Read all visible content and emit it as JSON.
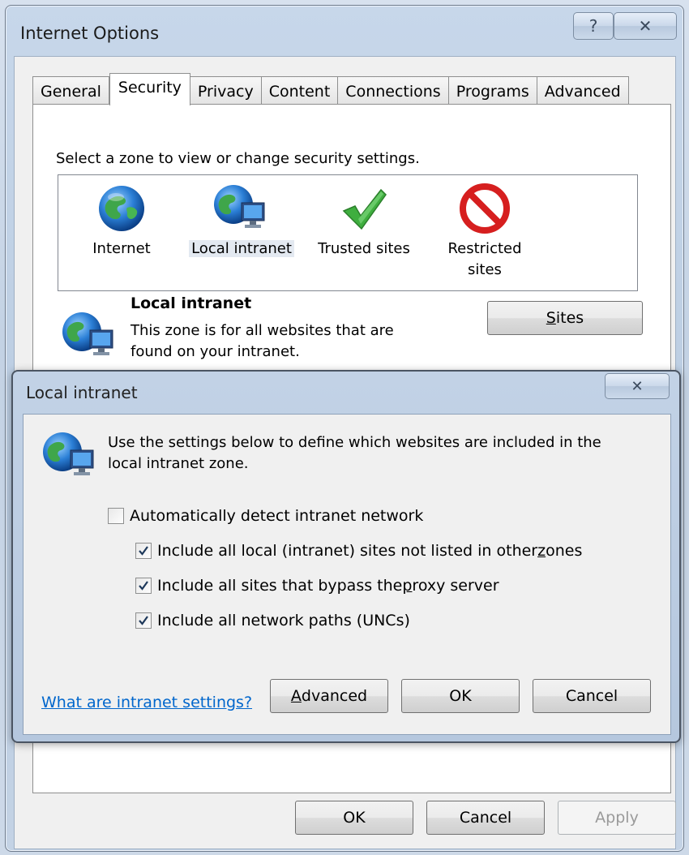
{
  "window": {
    "title": "Internet Options",
    "help_glyph": "?",
    "close_glyph": "✕"
  },
  "tabs": [
    {
      "label": "General"
    },
    {
      "label": "Security"
    },
    {
      "label": "Privacy"
    },
    {
      "label": "Content"
    },
    {
      "label": "Connections"
    },
    {
      "label": "Programs"
    },
    {
      "label": "Advanced"
    }
  ],
  "active_tab": "Security",
  "security": {
    "prompt": "Select a zone to view or change security settings.",
    "zones": [
      {
        "label": "Internet",
        "icon": "globe-icon"
      },
      {
        "label": "Local intranet",
        "icon": "intranet-icon"
      },
      {
        "label": "Trusted sites",
        "icon": "checkmark-icon"
      },
      {
        "label": "Restricted sites",
        "icon": "prohibited-icon"
      }
    ],
    "selected_zone": "Local intranet",
    "detail_title": "Local intranet",
    "detail_desc": "This zone is for all websites that are found on your intranet.",
    "sites_button": {
      "pre": "",
      "acc": "S",
      "post": "ites"
    }
  },
  "footer": {
    "ok": "OK",
    "cancel": "Cancel",
    "apply": "Apply"
  },
  "dialog": {
    "title": "Local intranet",
    "close_glyph": "✕",
    "description": "Use the settings below to define which websites are included in the local intranet zone.",
    "options": [
      {
        "pre": "Automatically detect intranet network",
        "acc": "",
        "post": "",
        "checked": false
      },
      {
        "pre": "Include all local (intranet) sites not listed in other ",
        "acc": "z",
        "post": "ones",
        "checked": true
      },
      {
        "pre": "Include all sites that bypass the ",
        "acc": "p",
        "post": "roxy server",
        "checked": true
      },
      {
        "pre": "Include all network paths (UNCs)",
        "acc": "",
        "post": "",
        "checked": true
      }
    ],
    "link": "What are intranet settings?",
    "advanced": {
      "pre": "",
      "acc": "A",
      "post": "dvanced"
    },
    "ok": "OK",
    "cancel": "Cancel"
  },
  "colors": {
    "link": "#0066cc",
    "check_green": "#3fae3f",
    "prohibited_red": "#d61f1f"
  }
}
